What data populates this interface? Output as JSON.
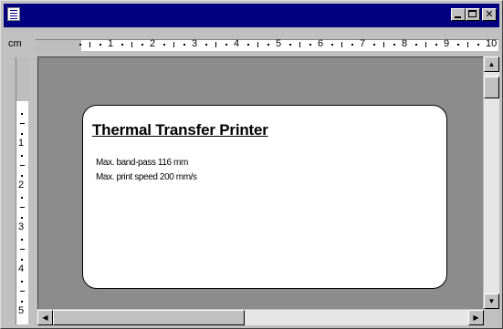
{
  "window": {
    "title": "",
    "controls": {
      "minimize": "_",
      "maximize": "□",
      "close": "✕"
    }
  },
  "ruler": {
    "unit": "cm",
    "horizontal_marks": [
      "1",
      "2",
      "3",
      "4",
      "5",
      "6",
      "7",
      "8",
      "9",
      "10"
    ],
    "vertical_marks": [
      "1",
      "2",
      "3",
      "4",
      "5"
    ]
  },
  "label": {
    "title": "Thermal Transfer Printer",
    "lines": [
      "Max. band-pass 116 mm",
      "Max. print speed 200 mm/s"
    ]
  },
  "scrollbars": {
    "up_arrow": "▲",
    "down_arrow": "▼",
    "left_arrow": "◀",
    "right_arrow": "▶"
  },
  "icons": [
    "system-menu-icon",
    "minimize-icon",
    "maximize-icon",
    "close-icon",
    "arrow-up-icon",
    "arrow-down-icon",
    "arrow-left-icon",
    "arrow-right-icon"
  ],
  "colors": {
    "titlebar": "#000080",
    "chrome": "#c0c0c0",
    "canvas": "#8c8c8c",
    "label": "#ffffff"
  }
}
